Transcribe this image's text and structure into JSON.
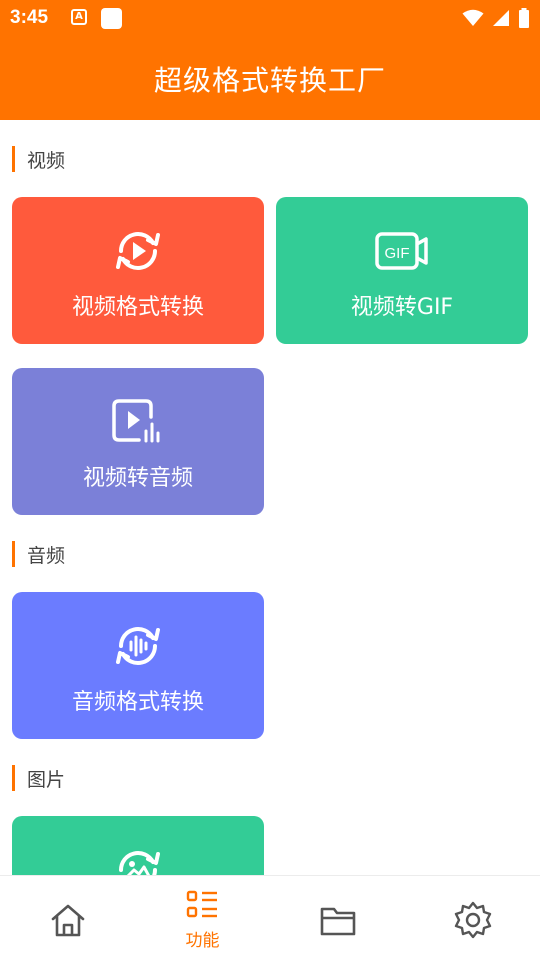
{
  "status_bar": {
    "time": "3:45",
    "left_icons": [
      "text-a-notification-icon",
      "square-notification-icon"
    ],
    "right_icons": [
      "wifi-icon",
      "signal-icon",
      "battery-icon"
    ]
  },
  "app_bar": {
    "title": "超级格式转换工厂"
  },
  "colors": {
    "primary": "#ff7300",
    "card_red": "#ff5a3c",
    "card_green": "#33cc96",
    "card_purple": "#7b80d8",
    "card_blue": "#6b7cff",
    "nav_inactive": "#555555"
  },
  "sections": [
    {
      "title": "视频",
      "cards": [
        {
          "label": "视频格式转换",
          "icon": "video-convert-icon",
          "color": "#ff5a3c"
        },
        {
          "label": "视频转GIF",
          "icon": "gif-icon",
          "color": "#33cc96"
        },
        {
          "label": "视频转音频",
          "icon": "video-to-audio-icon",
          "color": "#7b80d8"
        }
      ]
    },
    {
      "title": "音频",
      "cards": [
        {
          "label": "音频格式转换",
          "icon": "audio-convert-icon",
          "color": "#6b7cff"
        }
      ]
    },
    {
      "title": "图片",
      "cards": [
        {
          "label": "",
          "icon": "image-convert-icon",
          "color": "#33cc96"
        }
      ]
    }
  ],
  "bottom_nav": {
    "items": [
      {
        "icon": "home-icon",
        "label": "",
        "active": false
      },
      {
        "icon": "functions-list-icon",
        "label": "功能",
        "active": true
      },
      {
        "icon": "folder-icon",
        "label": "",
        "active": false
      },
      {
        "icon": "settings-gear-icon",
        "label": "",
        "active": false
      }
    ]
  }
}
